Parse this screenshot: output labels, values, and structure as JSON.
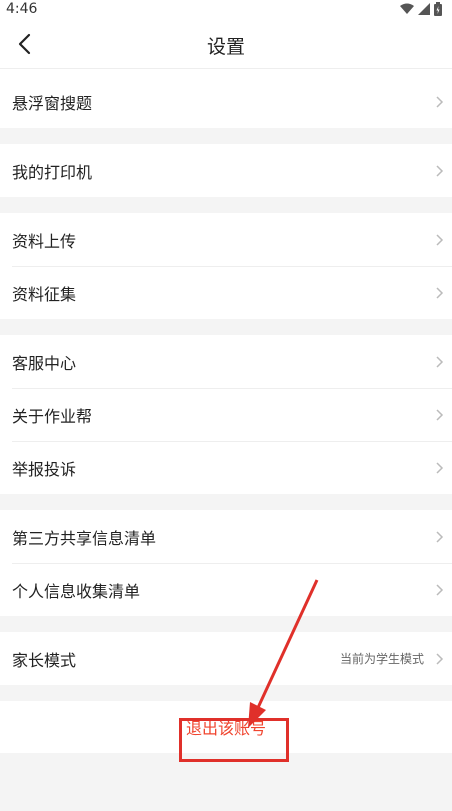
{
  "status_bar": {
    "time": "4:46"
  },
  "header": {
    "title": "设置"
  },
  "groups": [
    {
      "items": [
        {
          "label": "悬浮窗搜题"
        }
      ]
    },
    {
      "items": [
        {
          "label": "我的打印机"
        }
      ]
    },
    {
      "items": [
        {
          "label": "资料上传"
        },
        {
          "label": "资料征集"
        }
      ]
    },
    {
      "items": [
        {
          "label": "客服中心"
        },
        {
          "label": "关于作业帮"
        },
        {
          "label": "举报投诉"
        }
      ]
    },
    {
      "items": [
        {
          "label": "第三方共享信息清单"
        },
        {
          "label": "个人信息收集清单"
        }
      ]
    },
    {
      "items": [
        {
          "label": "家长模式",
          "value": "当前为学生模式"
        }
      ]
    }
  ],
  "logout": {
    "label": "退出该账号"
  },
  "colors": {
    "accent": "#f0452f",
    "annotation": "#e0302a"
  },
  "icons": [
    "back-arrow-icon",
    "wifi-icon",
    "signal-icon",
    "battery-icon",
    "chevron-right-icon"
  ]
}
